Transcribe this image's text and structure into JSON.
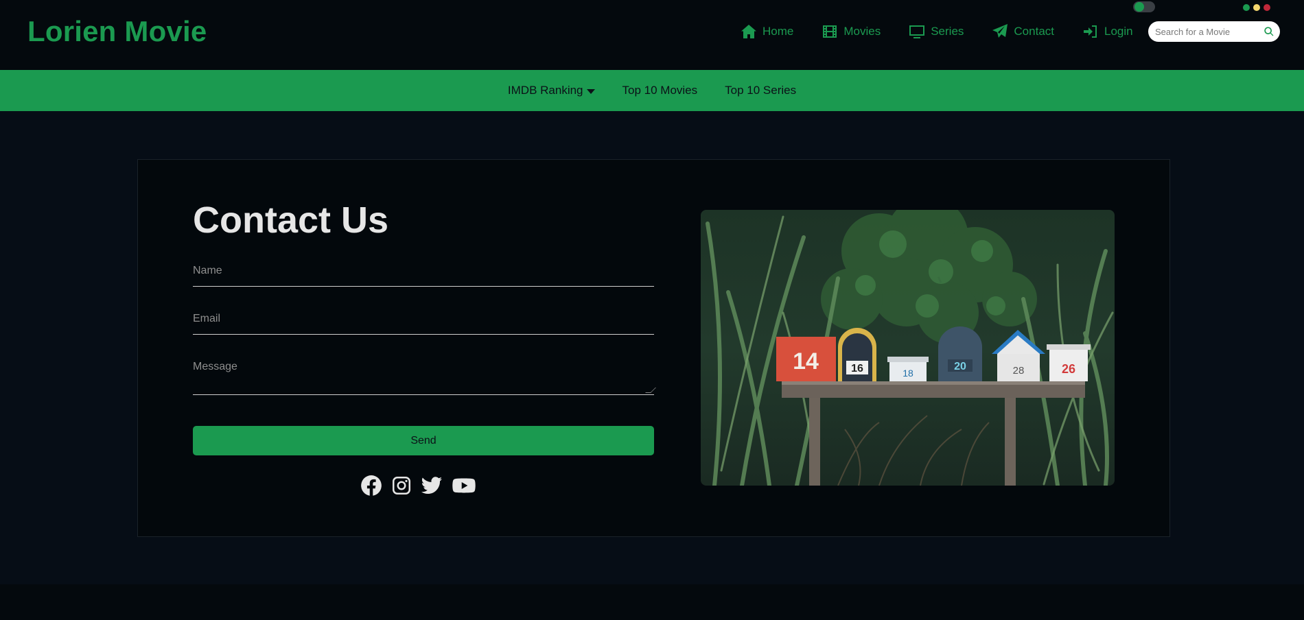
{
  "brand": {
    "title": "Lorien Movie"
  },
  "nav": [
    {
      "label": "Home",
      "icon": "home-icon"
    },
    {
      "label": "Movies",
      "icon": "film-icon"
    },
    {
      "label": "Series",
      "icon": "tv-icon"
    },
    {
      "label": "Contact",
      "icon": "paper-plane-icon"
    },
    {
      "label": "Login",
      "icon": "login-icon"
    }
  ],
  "search": {
    "placeholder": "Search for a Movie",
    "icon": "search-icon"
  },
  "window_controls": [
    "#1b9a50",
    "#f5d76e",
    "#c0283a"
  ],
  "subnav": [
    {
      "label": "IMDB Ranking",
      "icon": "caret-down-icon"
    },
    {
      "label": "Top 10 Movies"
    },
    {
      "label": "Top 10 Series"
    }
  ],
  "contact": {
    "title": "Contact Us",
    "name_placeholder": "Name",
    "email_placeholder": "Email",
    "message_placeholder": "Message",
    "send_label": "Send",
    "socials": [
      "facebook-icon",
      "instagram-icon",
      "twitter-icon",
      "youtube-icon"
    ]
  },
  "photo": {
    "mailbox_numbers": [
      "14",
      "16",
      "18",
      "20",
      "28",
      "26"
    ]
  },
  "colors": {
    "accent": "#1b9a50",
    "background": "#050c13",
    "text": "#e6e6e6"
  }
}
